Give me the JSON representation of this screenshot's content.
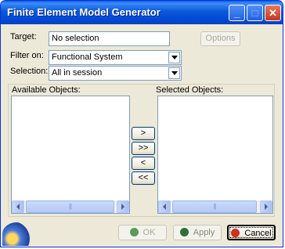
{
  "window": {
    "title": "Finite Element Model Generator"
  },
  "titlebar_buttons": {
    "minimize": "_",
    "maximize": "□",
    "close": "✕"
  },
  "form": {
    "target_label": "Target:",
    "target_value": "No selection",
    "options_label": "Options",
    "filter_label": "Filter on:",
    "filter_value": "Functional System",
    "selection_label": "Selection:",
    "selection_value": "All in session"
  },
  "lists": {
    "available_label": "Available Objects:",
    "selected_label": "Selected Objects:",
    "thumb_grip": "|||"
  },
  "transfer_buttons": {
    "add": ">",
    "add_all": ">>",
    "remove": "<",
    "remove_all": "<<"
  },
  "footer": {
    "ok_label": "OK",
    "apply_label": "Apply",
    "cancel_label": "Cancel"
  },
  "colors": {
    "titlebar": "#0a5ad9",
    "cancel_dot": "#d0301c",
    "ok_dot": "#5a9a5a",
    "apply_dot": "#2f6f38"
  }
}
